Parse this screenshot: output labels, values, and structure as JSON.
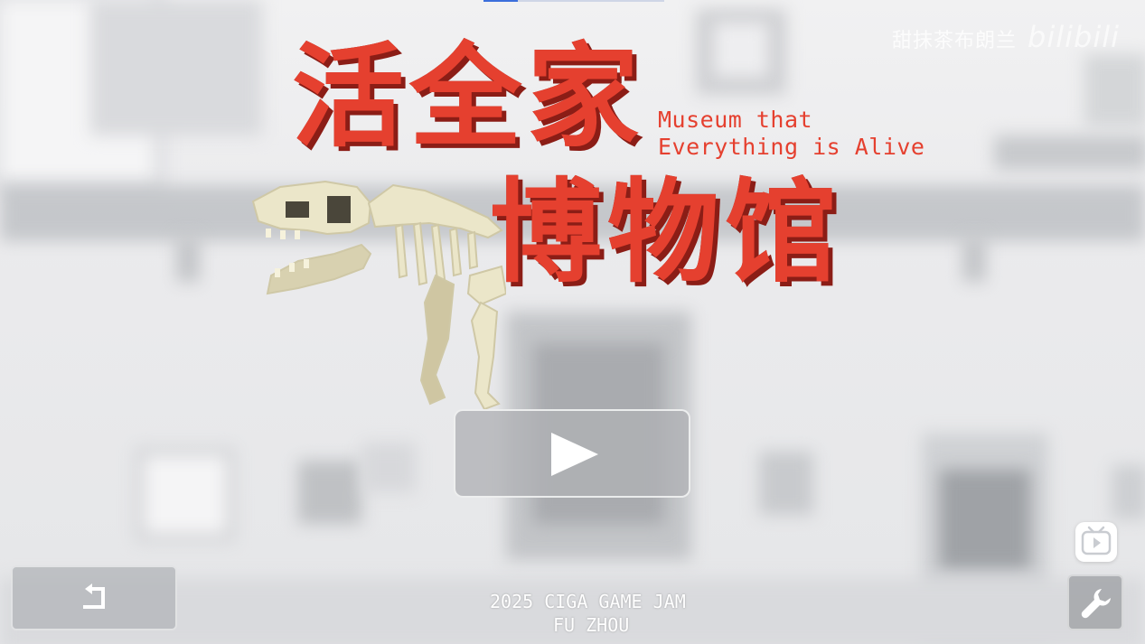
{
  "watermark": {
    "text": "甜抹茶布朗兰",
    "logo": "bilibili"
  },
  "title": {
    "cn_line1": "活全家",
    "cn_line2": "博物馆",
    "en_line1": "Museum that",
    "en_line2": "Everything is Alive"
  },
  "buttons": {
    "play_icon": "play-icon",
    "back_icon": "return-arrow-icon",
    "tv_icon": "bilibili-tv-icon",
    "settings_icon": "wrench-icon"
  },
  "credit": {
    "line1": "2025 CIGA  GAME JAM",
    "line2": "FU ZHOU"
  },
  "colors": {
    "title_red": "#e5402f",
    "title_shadow": "#8b1d16",
    "bone": "#ebe6c9"
  }
}
